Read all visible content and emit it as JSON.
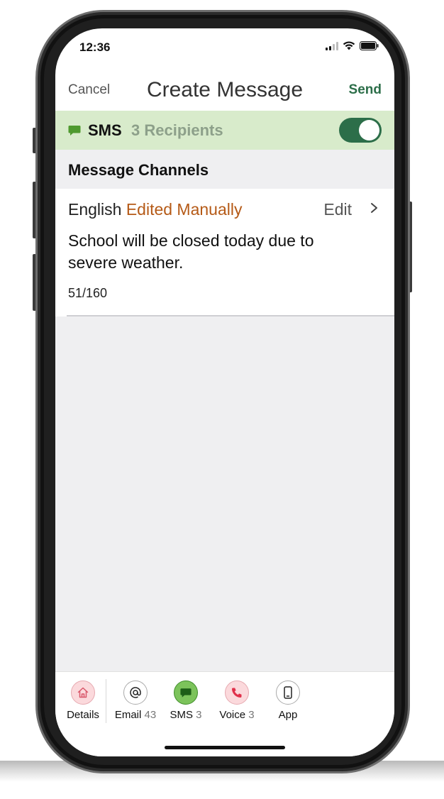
{
  "status_bar": {
    "time": "12:36"
  },
  "nav": {
    "cancel": "Cancel",
    "title": "Create Message",
    "send": "Send"
  },
  "sms_channel": {
    "label": "SMS",
    "recipients": "3 Recipients",
    "enabled": true
  },
  "section": {
    "header": "Message Channels"
  },
  "channel": {
    "language": "English",
    "status": "Edited Manually",
    "edit": "Edit",
    "message": "School will be closed today due to severe weather.",
    "char_count": "51/160"
  },
  "tabs": [
    {
      "label": "Details",
      "count": "",
      "icon": "home-icon"
    },
    {
      "label": "Email",
      "count": "43",
      "icon": "at-icon"
    },
    {
      "label": "SMS",
      "count": "3",
      "icon": "chat-bubble-icon"
    },
    {
      "label": "Voice",
      "count": "3",
      "icon": "phone-icon"
    },
    {
      "label": "App",
      "count": "",
      "icon": "mobile-device-icon"
    }
  ],
  "colors": {
    "accent_green": "#2c6e49",
    "sms_row_bg": "#d8ebcb",
    "edited_orange": "#b55a17",
    "details_bg": "#fbd9dc",
    "voice_bg": "#fbd9dc",
    "sms_tab_bg": "#7cc35b"
  }
}
